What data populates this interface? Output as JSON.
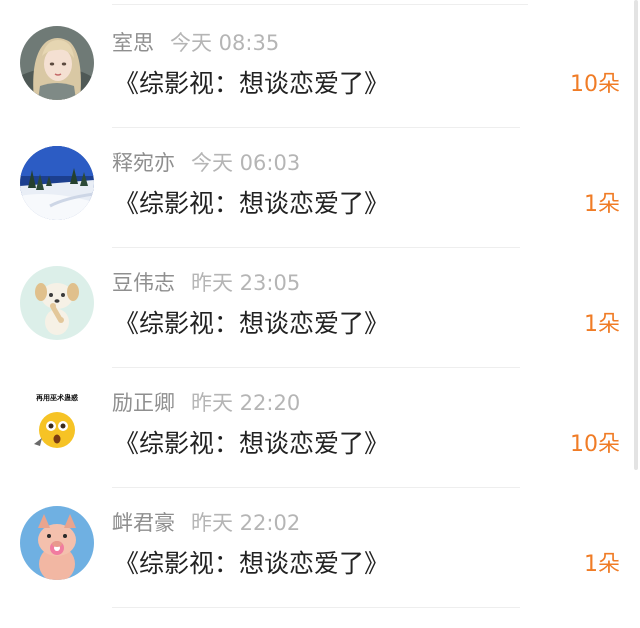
{
  "accent_color": "#f07c26",
  "items": [
    {
      "avatar_icon": "girl-portrait-avatar-icon",
      "name": "室思",
      "time": "今天 08:35",
      "content": "《综影视：想谈恋爱了》",
      "count": "10朵"
    },
    {
      "avatar_icon": "snowy-landscape-avatar-icon",
      "name": "释宛亦",
      "time": "今天 06:03",
      "content": "《综影视：想谈恋爱了》",
      "count": "1朵"
    },
    {
      "avatar_icon": "puppy-with-bone-avatar-icon",
      "name": "豆伟志",
      "time": "昨天 23:05",
      "content": "《综影视：想谈恋爱了》",
      "count": "1朵"
    },
    {
      "avatar_icon": "shocked-emoji-avatar-icon",
      "avatar_caption": "再用巫术蛊惑",
      "name": "励正卿",
      "time": "昨天 22:20",
      "content": "《综影视：想谈恋爱了》",
      "count": "10朵"
    },
    {
      "avatar_icon": "pig-with-pacifier-avatar-icon",
      "name": "衅君豪",
      "time": "昨天 22:02",
      "content": "《综影视：想谈恋爱了》",
      "count": "1朵"
    }
  ]
}
